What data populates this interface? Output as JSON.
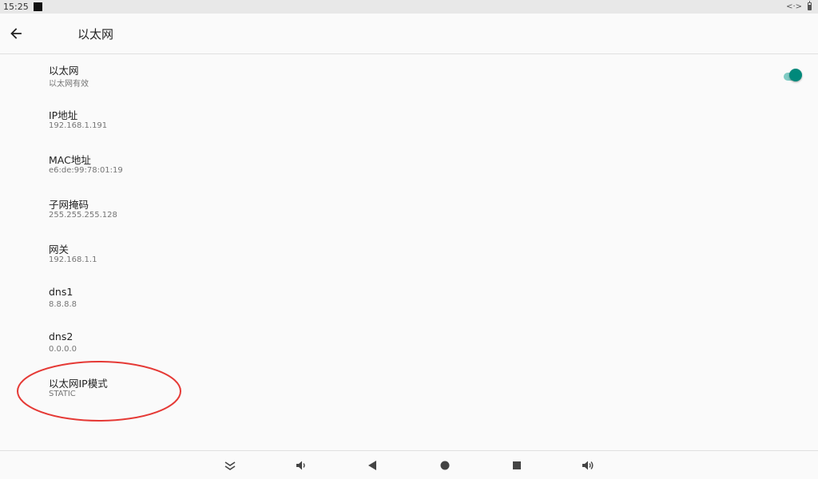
{
  "status_bar": {
    "time": "15:25",
    "ethernet_indicator": "<·>",
    "icons": [
      "notification-icon",
      "ethernet-icon",
      "battery-icon"
    ]
  },
  "app_bar": {
    "title": "以太网",
    "back_icon": "back-arrow-icon"
  },
  "preferences": [
    {
      "title": "以太网",
      "summary": "以太网有效",
      "switch_on": true
    },
    {
      "title": "IP地址",
      "summary": "192.168.1.191"
    },
    {
      "title": "MAC地址",
      "summary": "e6:de:99:78:01:19"
    },
    {
      "title": "子网掩码",
      "summary": "255.255.255.128"
    },
    {
      "title": "网关",
      "summary": "192.168.1.1"
    },
    {
      "title": "dns1",
      "summary": "8.8.8.8"
    },
    {
      "title": "dns2",
      "summary": "0.0.0.0"
    },
    {
      "title": "以太网IP模式",
      "summary": "STATIC",
      "highlighted": true
    }
  ],
  "nav_bar": {
    "buttons": [
      "collapse-icon",
      "volume-down-icon",
      "back-icon",
      "home-icon",
      "recents-icon",
      "volume-up-icon"
    ]
  },
  "colors": {
    "accent": "#00897b",
    "switch_track": "#80cbc4",
    "annotation": "#e53935",
    "background": "#fafafa"
  }
}
